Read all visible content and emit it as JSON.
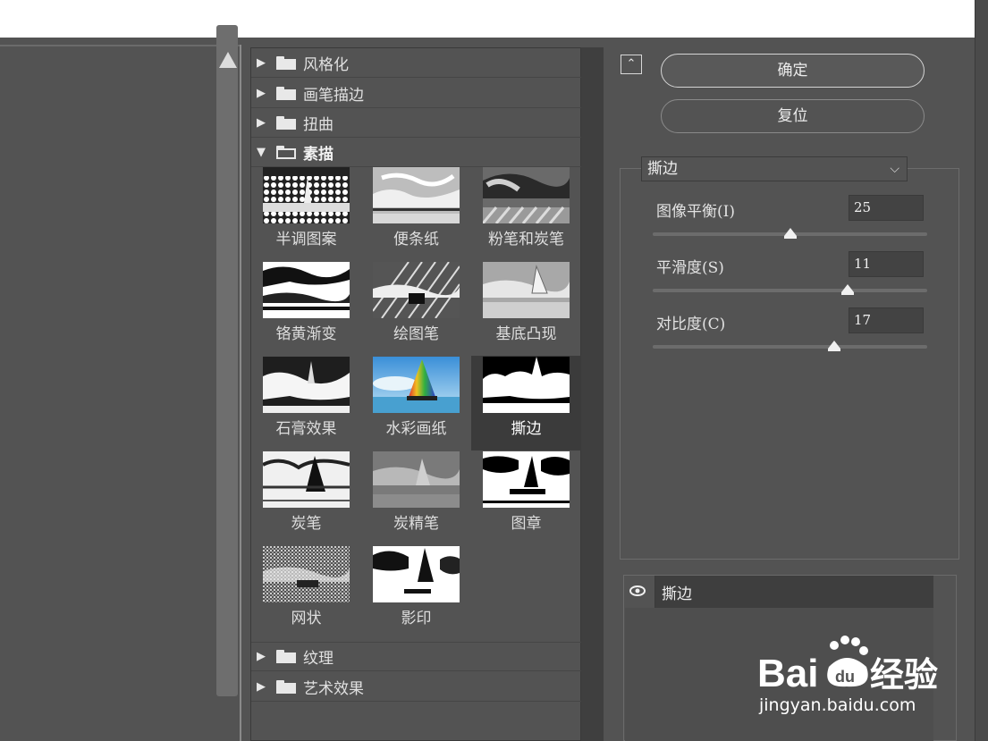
{
  "gallery": {
    "categories": [
      {
        "label": "风格化",
        "state": "collapsed"
      },
      {
        "label": "画笔描边",
        "state": "collapsed"
      },
      {
        "label": "扭曲",
        "state": "collapsed"
      },
      {
        "label": "素描",
        "state": "expanded"
      },
      {
        "label": "纹理",
        "state": "collapsed"
      },
      {
        "label": "艺术效果",
        "state": "collapsed"
      }
    ],
    "thumbnails": [
      {
        "label": "半调图案"
      },
      {
        "label": "便条纸"
      },
      {
        "label": "粉笔和炭笔"
      },
      {
        "label": "铬黄渐变"
      },
      {
        "label": "绘图笔"
      },
      {
        "label": "基底凸现"
      },
      {
        "label": "石膏效果"
      },
      {
        "label": "水彩画纸"
      },
      {
        "label": "撕边",
        "selected": true
      },
      {
        "label": "炭笔"
      },
      {
        "label": "炭精笔"
      },
      {
        "label": "图章"
      },
      {
        "label": "网状"
      },
      {
        "label": "影印"
      }
    ]
  },
  "settings": {
    "ok_label": "确定",
    "reset_label": "复位",
    "filter_selected": "撕边",
    "params": [
      {
        "label": "图像平衡(I)",
        "value": "25",
        "fraction": 0.5
      },
      {
        "label": "平滑度(S)",
        "value": "11",
        "fraction": 0.71
      },
      {
        "label": "对比度(C)",
        "value": "17",
        "fraction": 0.66
      }
    ]
  },
  "layers": {
    "item_label": "撕边"
  },
  "watermark": {
    "logo_text": "Bai 经验",
    "url": "jingyan.baidu.com"
  },
  "colors": {
    "panel": "#535353",
    "dark": "#3d3d3d",
    "text": "#e2e2e2",
    "selected_tile": "#3b3b3b"
  }
}
